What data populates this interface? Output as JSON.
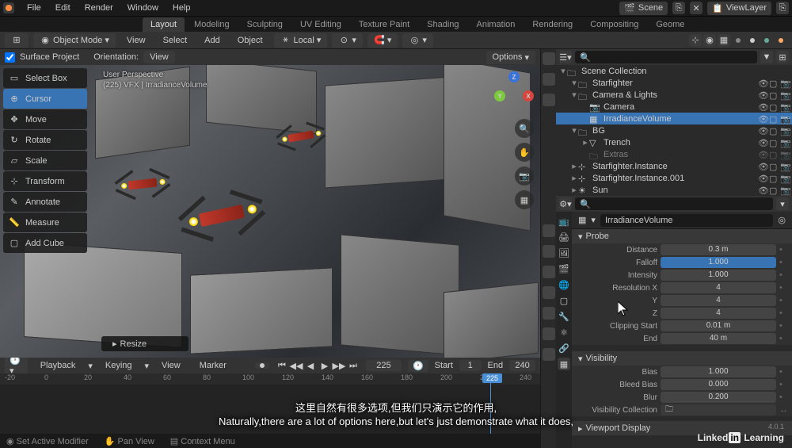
{
  "menu": {
    "items": [
      "File",
      "Edit",
      "Render",
      "Window",
      "Help"
    ]
  },
  "workspaces": {
    "items": [
      "Layout",
      "Modeling",
      "Sculpting",
      "UV Editing",
      "Texture Paint",
      "Shading",
      "Animation",
      "Rendering",
      "Compositing",
      "Geome"
    ],
    "active": 0
  },
  "scene_selector": {
    "label": "Scene"
  },
  "viewlayer_selector": {
    "label": "ViewLayer"
  },
  "toolbar": {
    "mode": "Object Mode",
    "view": "View",
    "select": "Select",
    "add": "Add",
    "object": "Object",
    "orient": "Local"
  },
  "vpheader": {
    "surface_project": "Surface Project",
    "orientation_label": "Orientation:",
    "orientation_value": "View",
    "options": "Options"
  },
  "vp_tools": [
    "Select Box",
    "Cursor",
    "Move",
    "Rotate",
    "Scale",
    "Transform",
    "Annotate",
    "Measure",
    "Add Cube"
  ],
  "vp_overlay": {
    "line1": "User Perspective",
    "line2": "(225) VFX | IrradianceVolume"
  },
  "resize_label": "Resize",
  "gizmo": {
    "x": "X",
    "y": "Y",
    "z": "Z"
  },
  "timeline": {
    "playback": "Playback",
    "keying": "Keying",
    "view": "View",
    "marker": "Marker",
    "current": "225",
    "start_label": "Start",
    "start": "1",
    "end_label": "End",
    "end": "240",
    "ticks": [
      "-20",
      "0",
      "20",
      "40",
      "60",
      "80",
      "100",
      "120",
      "140",
      "160",
      "180",
      "200",
      "220",
      "225",
      "240"
    ]
  },
  "status": {
    "left": "Set Active Modifier",
    "mid": "Pan View",
    "right": "Context Menu"
  },
  "outliner": {
    "scene_collection": "Scene Collection",
    "items": [
      {
        "name": "Starfighter",
        "indent": 1,
        "expand": "▾",
        "icon": "collection"
      },
      {
        "name": "Camera & Lights",
        "indent": 1,
        "expand": "▾",
        "icon": "collection"
      },
      {
        "name": "Camera",
        "indent": 2,
        "expand": "",
        "icon": "camera"
      },
      {
        "name": "IrradianceVolume",
        "indent": 2,
        "expand": "",
        "icon": "probe",
        "sel": true
      },
      {
        "name": "BG",
        "indent": 1,
        "expand": "▾",
        "icon": "collection"
      },
      {
        "name": "Trench",
        "indent": 2,
        "expand": "▸",
        "icon": "mesh"
      },
      {
        "name": "Extras",
        "indent": 2,
        "expand": "",
        "icon": "collection",
        "dim": true
      },
      {
        "name": "Starfighter.Instance",
        "indent": 1,
        "expand": "▸",
        "icon": "empty"
      },
      {
        "name": "Starfighter.Instance.001",
        "indent": 1,
        "expand": "▸",
        "icon": "empty"
      },
      {
        "name": "Sun",
        "indent": 1,
        "expand": "▸",
        "icon": "light"
      }
    ]
  },
  "properties": {
    "object_name": "IrradianceVolume",
    "probe_header": "Probe",
    "rows": [
      {
        "label": "Distance",
        "value": "0.3 m"
      },
      {
        "label": "Falloff",
        "value": "1.000",
        "blue": true
      },
      {
        "label": "Intensity",
        "value": "1.000"
      },
      {
        "label": "Resolution X",
        "value": "4"
      },
      {
        "label": "Y",
        "value": "4"
      },
      {
        "label": "Z",
        "value": "4"
      },
      {
        "label": "Clipping Start",
        "value": "0.01 m"
      },
      {
        "label": "End",
        "value": "40 m"
      }
    ],
    "visibility_header": "Visibility",
    "vis_rows": [
      {
        "label": "Bias",
        "value": "1.000"
      },
      {
        "label": "Bleed Bias",
        "value": "0.000"
      },
      {
        "label": "Blur",
        "value": "0.200"
      },
      {
        "label": "Visibility Collection",
        "value": ""
      }
    ],
    "viewport_display": "Viewport Display"
  },
  "subtitle": {
    "cn": "这里自然有很多选项,但我们只演示它的作用,",
    "en": "Naturally,there are a lot of options here,but let's just demonstrate what it does,"
  },
  "watermark": {
    "text1": "Linked",
    "in": "in",
    "text2": " Learning"
  },
  "version": "4.0.1"
}
